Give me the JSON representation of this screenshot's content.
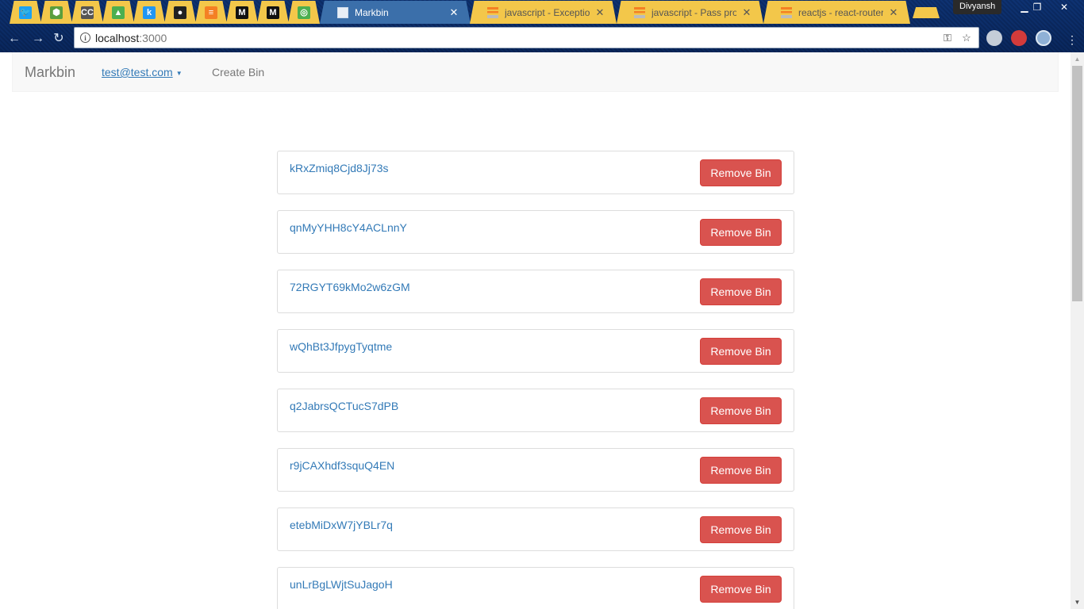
{
  "browser": {
    "pinned_tabs": [
      {
        "icon": "bird-icon",
        "color": "#1da1f2",
        "glyph": "🐦"
      },
      {
        "icon": "hexagon-icon",
        "color": "#5a9e3d",
        "glyph": "⬢"
      },
      {
        "icon": "cc-icon",
        "color": "#555555",
        "glyph": "CC"
      },
      {
        "icon": "drive-icon",
        "color": "#4caf50",
        "glyph": "▲"
      },
      {
        "icon": "k-icon",
        "color": "#2196f3",
        "glyph": "k"
      },
      {
        "icon": "github-icon",
        "color": "#222222",
        "glyph": "●"
      },
      {
        "icon": "stackoverflow-icon",
        "color": "#f48024",
        "glyph": "≡"
      },
      {
        "icon": "medium-icon",
        "color": "#111111",
        "glyph": "M"
      },
      {
        "icon": "medium-icon",
        "color": "#111111",
        "glyph": "M"
      },
      {
        "icon": "circle-app-icon",
        "color": "#4caf50",
        "glyph": "◎"
      }
    ],
    "tabs": [
      {
        "title": "Markbin",
        "active": true,
        "icon": "page-icon"
      },
      {
        "title": "javascript - Exception in",
        "active": false,
        "icon": "stackoverflow-icon"
      },
      {
        "title": "javascript - Pass props",
        "active": false,
        "icon": "stackoverflow-icon"
      },
      {
        "title": "reactjs - react-router: H",
        "active": false,
        "icon": "stackoverflow-icon"
      }
    ],
    "profile_name": "Divyansh",
    "window_controls": {
      "minimize": "▁",
      "restore": "❐",
      "close": "✕"
    },
    "url_host": "localhost",
    "url_port": ":3000"
  },
  "navbar": {
    "brand": "Markbin",
    "user_email": "test@test.com",
    "create_label": "Create Bin"
  },
  "bins": [
    {
      "id": "kRxZmiq8Cjd8Jj73s",
      "button": "Remove Bin"
    },
    {
      "id": "qnMyYHH8cY4ACLnnY",
      "button": "Remove Bin"
    },
    {
      "id": "72RGYT69kMo2w6zGM",
      "button": "Remove Bin"
    },
    {
      "id": "wQhBt3JfpygTyqtme",
      "button": "Remove Bin"
    },
    {
      "id": "q2JabrsQCTucS7dPB",
      "button": "Remove Bin"
    },
    {
      "id": "r9jCAXhdf3squQ4EN",
      "button": "Remove Bin"
    },
    {
      "id": "etebMiDxW7jYBLr7q",
      "button": "Remove Bin"
    },
    {
      "id": "unLrBgLWjtSuJagoH",
      "button": "Remove Bin"
    }
  ],
  "colors": {
    "danger": "#d9534f",
    "link": "#337ab7",
    "tab_yellow": "#f3c74a"
  }
}
